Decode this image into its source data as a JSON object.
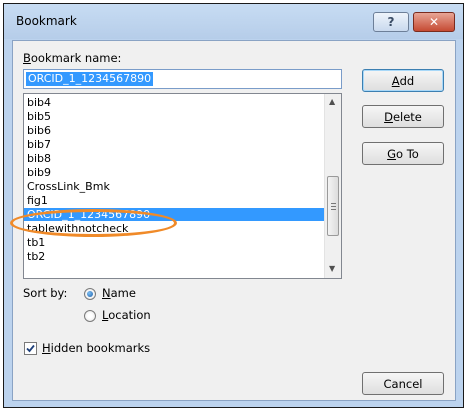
{
  "dialog": {
    "title": "Bookmark",
    "help_label": "?",
    "close_label": "✕"
  },
  "bookmark_name": {
    "label_prefix": "",
    "label_access": "B",
    "label_rest": "ookmark name:",
    "value": "ORCID_1_1234567890"
  },
  "bookmarks": [
    {
      "name": "bib4",
      "selected": false
    },
    {
      "name": "bib5",
      "selected": false
    },
    {
      "name": "bib6",
      "selected": false
    },
    {
      "name": "bib7",
      "selected": false
    },
    {
      "name": "bib8",
      "selected": false
    },
    {
      "name": "bib9",
      "selected": false
    },
    {
      "name": "CrossLink_Bmk",
      "selected": false
    },
    {
      "name": "fig1",
      "selected": false
    },
    {
      "name": "ORCID_1_1234567890",
      "selected": true
    },
    {
      "name": "tablewithnotcheck",
      "selected": false
    },
    {
      "name": "tb1",
      "selected": false
    },
    {
      "name": "tb2",
      "selected": false
    }
  ],
  "buttons": {
    "add": {
      "access": "A",
      "rest": "dd"
    },
    "delete": {
      "access": "D",
      "rest": "elete"
    },
    "goto": {
      "access": "G",
      "rest": "o To"
    },
    "cancel": "Cancel"
  },
  "sort": {
    "label": "Sort by:",
    "name_access": "N",
    "name_rest": "ame",
    "location_access": "L",
    "location_rest": "ocation",
    "selected": "name"
  },
  "hidden": {
    "access": "H",
    "rest": "idden bookmarks",
    "checked": true
  },
  "colors": {
    "selection": "#3399ff",
    "highlight_ring": "#f08a28",
    "frame": "#bcd3ee"
  }
}
